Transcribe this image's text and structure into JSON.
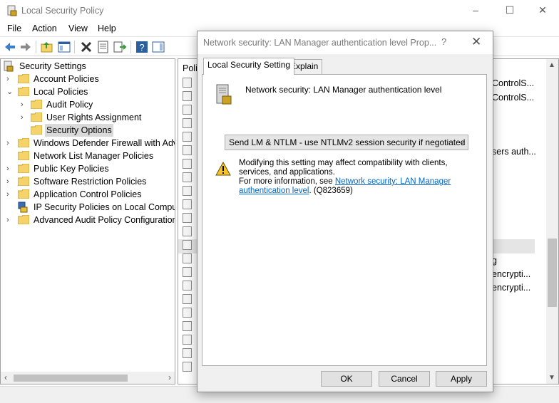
{
  "window": {
    "title": "Local Security Policy",
    "minimize": "–",
    "maximize": "☐",
    "close": "✕"
  },
  "menu": [
    "File",
    "Action",
    "View",
    "Help"
  ],
  "tree": {
    "items": [
      {
        "label": "Security Settings",
        "level": 0,
        "expanded": true
      },
      {
        "label": "Account Policies",
        "level": 1,
        "expanded": false
      },
      {
        "label": "Local Policies",
        "level": 1,
        "expanded": true
      },
      {
        "label": "Audit Policy",
        "level": 2,
        "expanded": false
      },
      {
        "label": "User Rights Assignment",
        "level": 2,
        "expanded": false
      },
      {
        "label": "Security Options",
        "level": 2,
        "selected": true
      },
      {
        "label": "Windows Defender Firewall with Adva",
        "level": 1,
        "expanded": false
      },
      {
        "label": "Network List Manager Policies",
        "level": 1
      },
      {
        "label": "Public Key Policies",
        "level": 1,
        "expanded": false
      },
      {
        "label": "Software Restriction Policies",
        "level": 1,
        "expanded": false
      },
      {
        "label": "Application Control Policies",
        "level": 1,
        "expanded": false
      },
      {
        "label": "IP Security Policies on Local Compute",
        "level": 1
      },
      {
        "label": "Advanced Audit Policy Configuration",
        "level": 1,
        "expanded": false
      }
    ]
  },
  "list": {
    "header": "Polic",
    "right_texts": [
      "ControlS...",
      "ControlS...",
      "sers auth...",
      "g",
      "encrypti...",
      "encrypti..."
    ]
  },
  "dialog": {
    "title": "Network security: LAN Manager authentication level Prop...",
    "help": "?",
    "close": "✕",
    "tabs": [
      "Local Security Setting",
      "Explain"
    ],
    "policy_name": "Network security: LAN Manager authentication level",
    "selected_value": "Send LM & NTLM - use NTLMv2 session security if negotiated",
    "warning_line1": "Modifying this setting may affect compatibility with clients, services, and applications.",
    "warning_line2_prefix": "For more information, see ",
    "warning_link": "Network security: LAN Manager authentication level",
    "warning_suffix": ". (Q823659)",
    "buttons": {
      "ok": "OK",
      "cancel": "Cancel",
      "apply": "Apply"
    }
  },
  "colors": {
    "link": "#0066cc",
    "folder": "#f5d36b",
    "selection": "#d9d9d9"
  }
}
